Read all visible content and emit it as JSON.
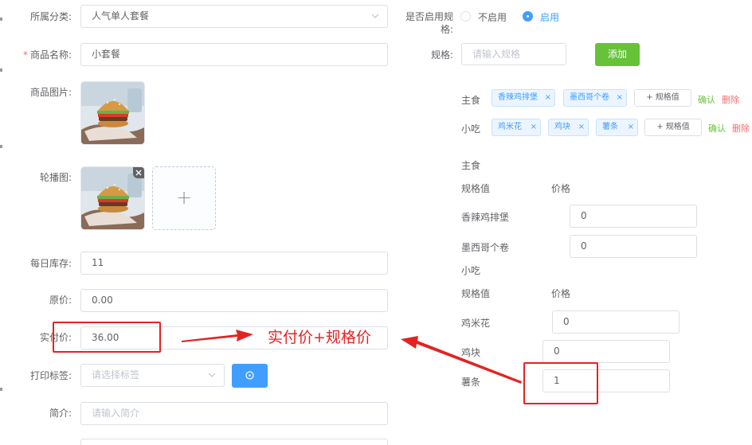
{
  "form": {
    "category": {
      "label": "所属分类:",
      "value": "人气单人套餐"
    },
    "name": {
      "required_mark": "*",
      "label": "商品名称:",
      "value": "小套餐"
    },
    "image": {
      "label": "商品图片:"
    },
    "carousel": {
      "label": "轮播图:",
      "add_icon": "+"
    },
    "stock": {
      "label": "每日库存:",
      "value": "11"
    },
    "original_price": {
      "label": "原价:",
      "value": "0.00"
    },
    "actual_price": {
      "label": "实付价:",
      "value": "36.00"
    },
    "print_tag": {
      "label": "打印标签:",
      "placeholder": "请选择标签"
    },
    "intro": {
      "label": "简介:",
      "placeholder": "请输入简介"
    }
  },
  "spec": {
    "enable": {
      "label": "是否启用规格:",
      "off": "不启用",
      "on": "启用",
      "selected": "启用"
    },
    "input": {
      "label": "规格:",
      "placeholder": "请输入规格",
      "add_button": "添加"
    },
    "groups": [
      {
        "name": "主食",
        "tags": [
          "香辣鸡排堡",
          "墨西哥个卷"
        ],
        "add_value": "+ 规格值",
        "confirm": "确认",
        "delete": "删除"
      },
      {
        "name": "小吃",
        "tags": [
          "鸡米花",
          "鸡块",
          "薯条"
        ],
        "add_value": "+ 规格值",
        "confirm": "确认",
        "delete": "删除"
      }
    ],
    "price_tables": [
      {
        "group": "主食",
        "col_value": "规格值",
        "col_price": "价格",
        "rows": [
          {
            "name": "香辣鸡排堡",
            "price": "0"
          },
          {
            "name": "墨西哥个卷",
            "price": "0"
          }
        ]
      },
      {
        "group": "小吃",
        "col_value": "规格值",
        "col_price": "价格",
        "rows": [
          {
            "name": "鸡米花",
            "price": "0"
          },
          {
            "name": "鸡块",
            "price": "0"
          },
          {
            "name": "薯条",
            "price": "1"
          }
        ]
      }
    ]
  },
  "annotation": {
    "text": "实付价+规格价",
    "color": "#e52222"
  }
}
